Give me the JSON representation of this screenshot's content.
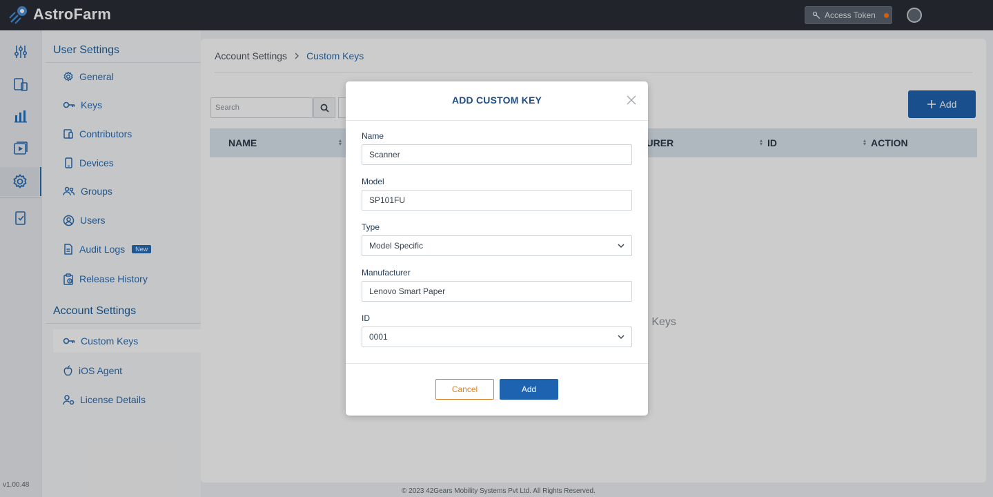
{
  "app": {
    "name": "AstroFarm",
    "version": "v1.00.48"
  },
  "topbar": {
    "access_token_label": "Access Token"
  },
  "sidebar": {
    "user_settings_title": "User Settings",
    "user_items": [
      {
        "label": "General",
        "icon": "gear-icon"
      },
      {
        "label": "Keys",
        "icon": "key-icon"
      },
      {
        "label": "Contributors",
        "icon": "contributors-icon"
      },
      {
        "label": "Devices",
        "icon": "phone-icon"
      },
      {
        "label": "Groups",
        "icon": "groups-icon"
      },
      {
        "label": "Users",
        "icon": "user-circle-icon"
      },
      {
        "label": "Audit Logs",
        "icon": "document-icon",
        "badge": "New"
      },
      {
        "label": "Release History",
        "icon": "clipboard-icon"
      }
    ],
    "account_settings_title": "Account Settings",
    "account_items": [
      {
        "label": "Custom Keys",
        "icon": "key-icon",
        "active": true
      },
      {
        "label": "iOS Agent",
        "icon": "apple-icon"
      },
      {
        "label": "License Details",
        "icon": "license-user-icon"
      }
    ]
  },
  "breadcrumb": {
    "parent": "Account Settings",
    "current": "Custom Keys"
  },
  "toolbar": {
    "search_placeholder": "Search",
    "add_label": "Add"
  },
  "table": {
    "columns": [
      "NAME",
      "TURER",
      "ID",
      "ACTION"
    ],
    "empty_text": "n Keys"
  },
  "footer": {
    "copyright": "© 2023 42Gears Mobility Systems Pvt Ltd. All Rights Reserved."
  },
  "modal": {
    "title": "ADD CUSTOM KEY",
    "fields": {
      "name": {
        "label": "Name",
        "value": "Scanner"
      },
      "model": {
        "label": "Model",
        "value": "SP101FU"
      },
      "type": {
        "label": "Type",
        "value": "Model Specific"
      },
      "manufacturer": {
        "label": "Manufacturer",
        "value": "Lenovo Smart Paper"
      },
      "id": {
        "label": "ID",
        "value": "0001"
      }
    },
    "cancel_label": "Cancel",
    "add_label": "Add"
  },
  "colors": {
    "accent": "#1e63b0",
    "topbar": "#2a2f36",
    "cancel": "#d9822b"
  }
}
